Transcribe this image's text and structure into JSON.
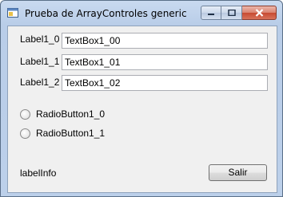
{
  "window": {
    "title": "Prueba de ArrayControles generic"
  },
  "rows": [
    {
      "label": "Label1_0",
      "textbox": "TextBox1_00"
    },
    {
      "label": "Label1_1",
      "textbox": "TextBox1_01"
    },
    {
      "label": "Label1_2",
      "textbox": "TextBox1_02"
    }
  ],
  "radios": [
    {
      "label": "RadioButton1_0"
    },
    {
      "label": "RadioButton1_1"
    }
  ],
  "footer": {
    "info_label": "labelInfo",
    "exit_button": "Salir"
  }
}
